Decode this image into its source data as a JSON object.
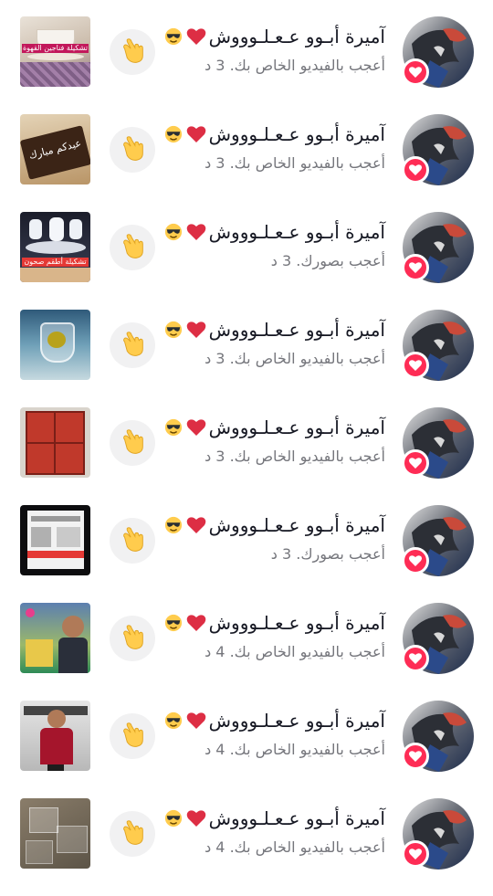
{
  "notifications": [
    {
      "user_name": "آميرة أبـوو عـعـلـوووش",
      "action": "أعجب بالفيديو الخاص بك.",
      "time": "3 د",
      "thumb": "cups",
      "thumb_text": "تشكيلة فناجين القهوة"
    },
    {
      "user_name": "آميرة أبـوو عـعـلـوووش",
      "action": "أعجب بالفيديو الخاص بك.",
      "time": "3 د",
      "thumb": "chocolate",
      "thumb_text": "عيدكم مبارك"
    },
    {
      "user_name": "آميرة أبـوو عـعـلـوووش",
      "action": "أعجب بصورك.",
      "time": "3 د",
      "thumb": "dishes",
      "thumb_text": "تشكيلة أطقم صحون"
    },
    {
      "user_name": "آميرة أبـوو عـعـلـوووش",
      "action": "أعجب بالفيديو الخاص بك.",
      "time": "3 د",
      "thumb": "glass",
      "thumb_text": ""
    },
    {
      "user_name": "آميرة أبـوو عـعـلـوووش",
      "action": "أعجب بالفيديو الخاص بك.",
      "time": "3 د",
      "thumb": "wardrobe",
      "thumb_text": ""
    },
    {
      "user_name": "آميرة أبـوو عـعـلـوووش",
      "action": "أعجب بصورك.",
      "time": "3 د",
      "thumb": "screen",
      "thumb_text": ""
    },
    {
      "user_name": "آميرة أبـوو عـعـلـوووش",
      "action": "أعجب بالفيديو الخاص بك.",
      "time": "4 د",
      "thumb": "shop1",
      "thumb_text": ""
    },
    {
      "user_name": "آميرة أبـوو عـعـلـوووش",
      "action": "أعجب بالفيديو الخاص بك.",
      "time": "4 د",
      "thumb": "shop2",
      "thumb_text": ""
    },
    {
      "user_name": "آميرة أبـوو عـعـلـوووش",
      "action": "أعجب بالفيديو الخاص بك.",
      "time": "4 د",
      "thumb": "bags",
      "thumb_text": ""
    }
  ],
  "icons": {
    "emoji_sunglasses": "sunglasses-face-icon",
    "emoji_heart": "red-heart-icon",
    "hand": "pointing-hand-icon",
    "badge": "heart-badge-icon"
  },
  "colors": {
    "badge": "#fe2c55",
    "name": "#161823",
    "subtext": "#75767c",
    "hand_bg": "#f1f1f2"
  }
}
